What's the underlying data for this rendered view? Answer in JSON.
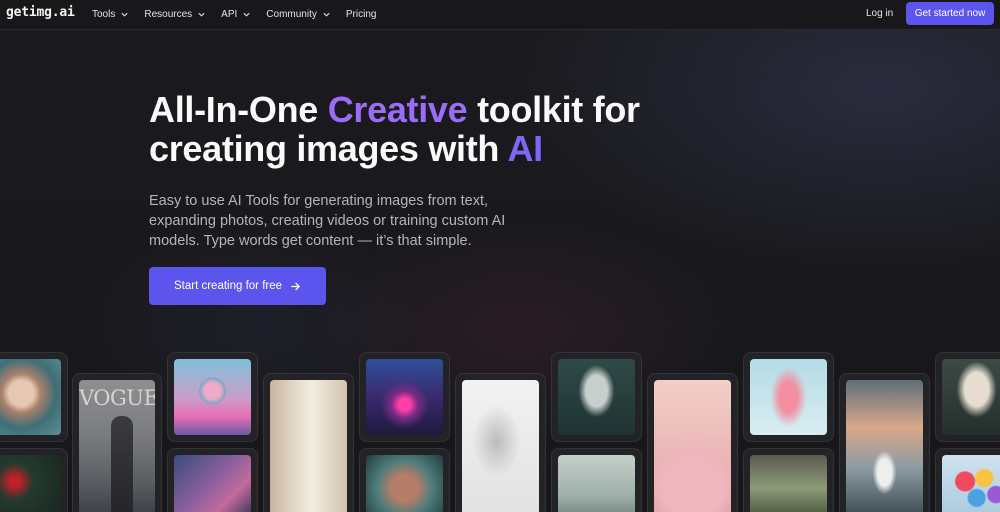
{
  "nav": {
    "logo": "getimg.ai",
    "menu": [
      {
        "label": "Tools",
        "has_dropdown": true
      },
      {
        "label": "Resources",
        "has_dropdown": true
      },
      {
        "label": "API",
        "has_dropdown": true
      },
      {
        "label": "Community",
        "has_dropdown": true
      },
      {
        "label": "Pricing",
        "has_dropdown": false
      }
    ],
    "login": "Log in",
    "cta": "Get started now"
  },
  "hero": {
    "title_part1": "All-In-One ",
    "title_accent1": "Creative",
    "title_part2": " toolkit for creating images with ",
    "title_accent2": "AI",
    "subtitle": "Easy to use AI Tools for generating images from text, expanding photos, creating videos or training custom AI models. Type words get content — it’s that simple.",
    "cta": "Start creating for free",
    "cta_icon": "arrow-right-icon"
  },
  "gallery": {
    "magazine_cover_text": "VOGUE"
  },
  "colors": {
    "accent": "#5b55ee",
    "title_accent": "#9b6cf6",
    "background": "#19191c"
  }
}
